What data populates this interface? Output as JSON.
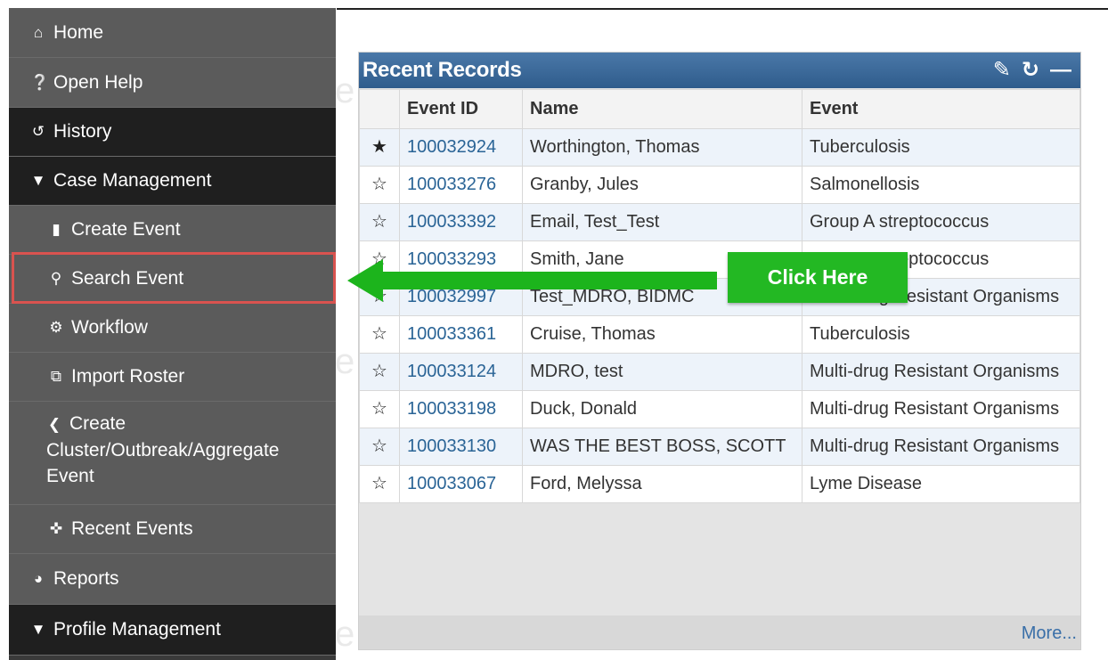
{
  "sidebar": {
    "items": [
      {
        "label": "Home",
        "icon": "home-icon"
      },
      {
        "label": "Open Help",
        "icon": "question-icon"
      },
      {
        "label": "History",
        "icon": "history-icon"
      },
      {
        "label": "Case Management",
        "icon": "caret-down-icon"
      },
      {
        "label": "Create Event",
        "icon": "file-icon"
      },
      {
        "label": "Search Event",
        "icon": "search-icon"
      },
      {
        "label": "Workflow",
        "icon": "cogs-icon"
      },
      {
        "label": "Import Roster",
        "icon": "import-icon"
      },
      {
        "label": "Create Cluster/Outbreak/Aggregate Event",
        "icon": "share-icon"
      },
      {
        "label": "Recent Events",
        "icon": "pin-icon"
      },
      {
        "label": "Reports",
        "icon": "pie-chart-icon"
      },
      {
        "label": "Profile Management",
        "icon": "caret-down-icon"
      }
    ]
  },
  "panel": {
    "title": "Recent Records",
    "tools": {
      "edit": "pencil-icon",
      "refresh": "refresh-icon",
      "collapse": "minus-icon"
    },
    "columns": [
      "Event ID",
      "Name",
      "Event"
    ],
    "rows": [
      {
        "starred": true,
        "star": "★",
        "event_id": "100032924",
        "name": "Worthington, Thomas",
        "event": "Tuberculosis"
      },
      {
        "starred": false,
        "star": "☆",
        "event_id": "100033276",
        "name": "Granby, Jules",
        "event": "Salmonellosis"
      },
      {
        "starred": false,
        "star": "☆",
        "event_id": "100033392",
        "name": "Email, Test_Test",
        "event": "Group A streptococcus"
      },
      {
        "starred": false,
        "star": "☆",
        "event_id": "100033293",
        "name": "Smith, Jane",
        "event": "Group A streptococcus"
      },
      {
        "starred": false,
        "star": "☆",
        "event_id": "100032997",
        "name": "Test_MDRO, BIDMC",
        "event": "Multi-drug Resistant Organisms"
      },
      {
        "starred": false,
        "star": "☆",
        "event_id": "100033361",
        "name": "Cruise, Thomas",
        "event": "Tuberculosis"
      },
      {
        "starred": false,
        "star": "☆",
        "event_id": "100033124",
        "name": "MDRO, test",
        "event": "Multi-drug Resistant Organisms"
      },
      {
        "starred": false,
        "star": "☆",
        "event_id": "100033198",
        "name": "Duck, Donald",
        "event": "Multi-drug Resistant Organisms"
      },
      {
        "starred": false,
        "star": "☆",
        "event_id": "100033130",
        "name": "WAS THE BEST BOSS, SCOTT",
        "event": "Multi-drug Resistant Organisms"
      },
      {
        "starred": false,
        "star": "☆",
        "event_id": "100033067",
        "name": "Ford, Melyssa",
        "event": "Lyme Disease"
      }
    ],
    "more_label": "More..."
  },
  "callout": {
    "label": "Click Here",
    "color": "#23b823"
  },
  "colors": {
    "panel_header": "#2f5c8c",
    "highlight": "#d9534f",
    "sidebar_dark": "#1f1f1f",
    "sidebar_gray": "#5b5b5b"
  }
}
